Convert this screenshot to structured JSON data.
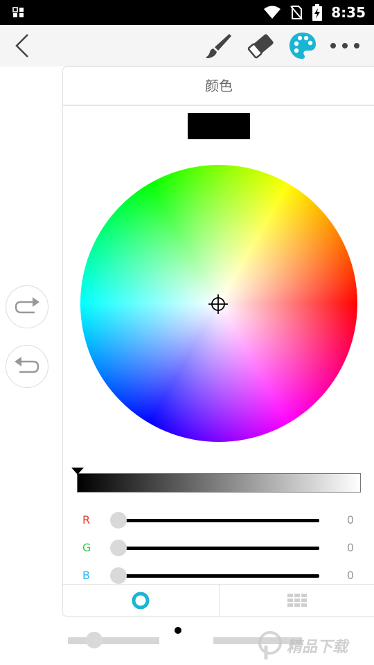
{
  "status_bar": {
    "time": "8:35"
  },
  "toolbar": {
    "icons": [
      "back-chevron-icon",
      "brush-icon",
      "eraser-icon",
      "palette-icon",
      "more-icon"
    ],
    "accent_color": "#1ab5d3"
  },
  "side_buttons": {
    "icons": [
      "redo-icon",
      "undo-icon"
    ]
  },
  "color_panel": {
    "title": "颜色",
    "current_color": "#000000",
    "brightness_level": 0,
    "sliders": [
      {
        "label": "R",
        "value": "0",
        "color": "#e53935"
      },
      {
        "label": "G",
        "value": "0",
        "color": "#2ecc40"
      },
      {
        "label": "B",
        "value": "0",
        "color": "#29b6f6"
      }
    ],
    "tabs": [
      "color-wheel-tab",
      "swatch-grid-tab"
    ]
  },
  "watermark": {
    "text": "精品下载"
  }
}
